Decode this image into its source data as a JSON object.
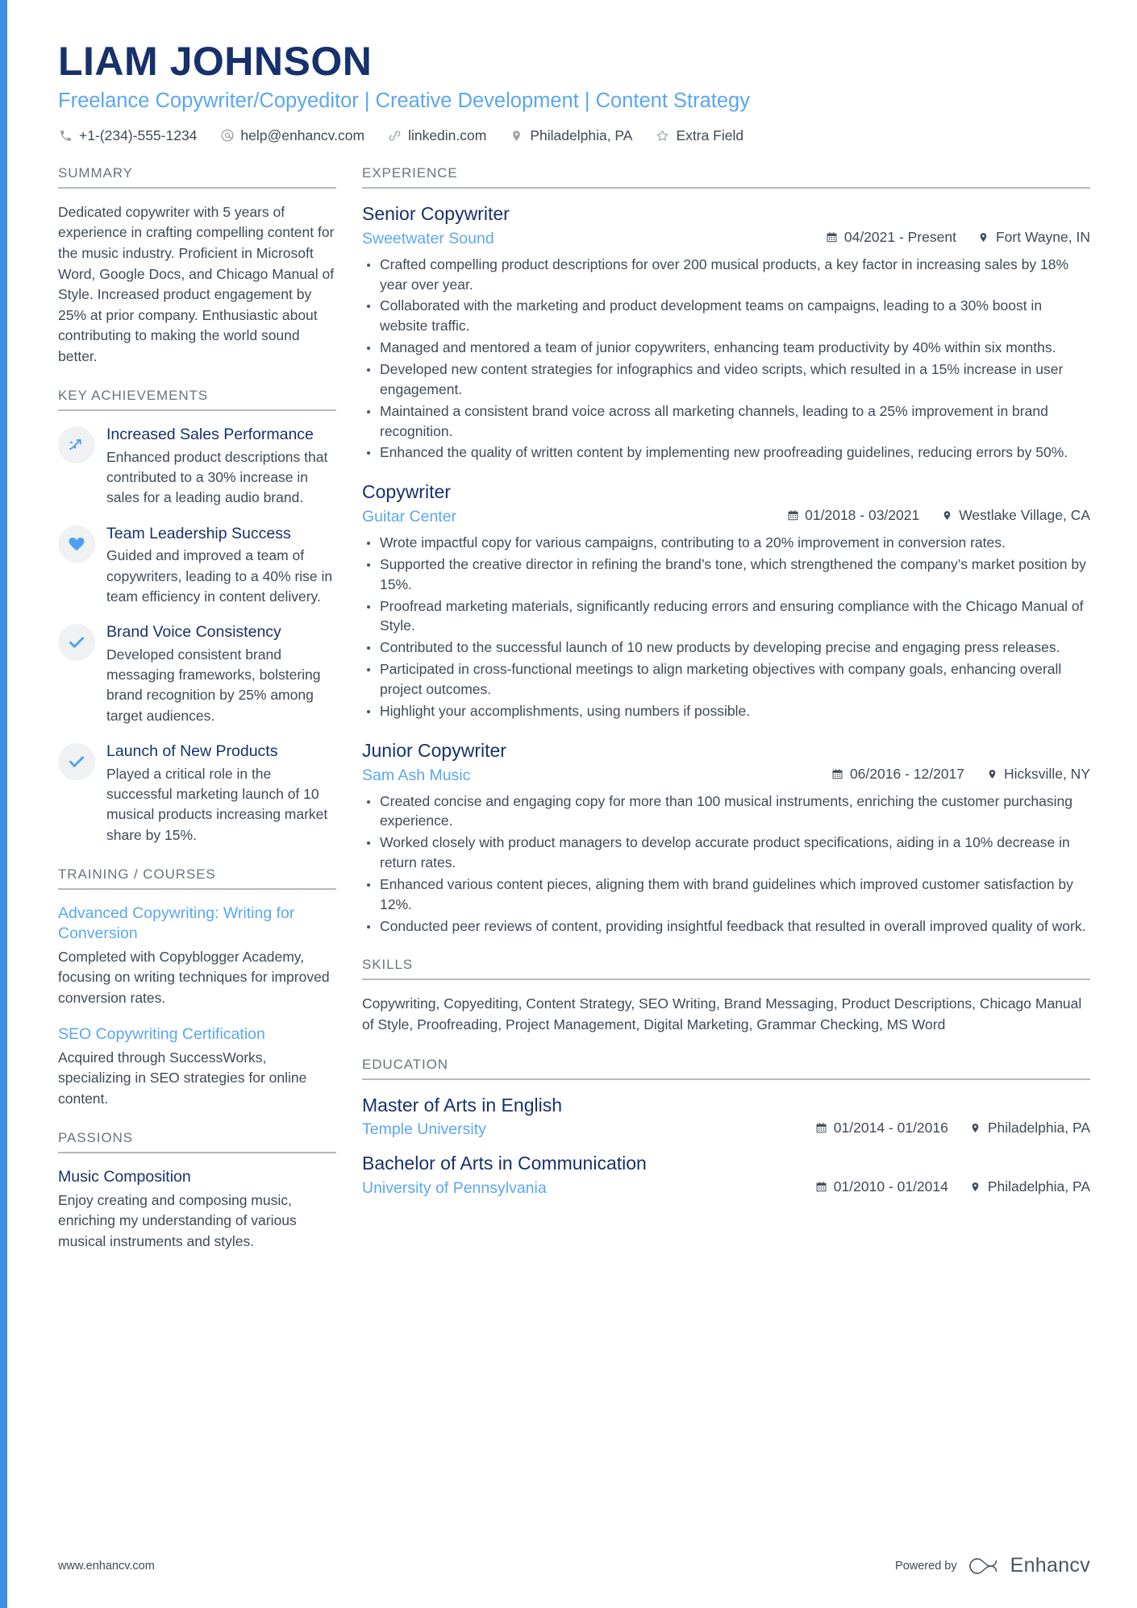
{
  "header": {
    "name": "LIAM JOHNSON",
    "headline": "Freelance Copywriter/Copyeditor | Creative Development | Content Strategy",
    "contacts": [
      {
        "icon": "phone-icon",
        "text": "+1-(234)-555-1234"
      },
      {
        "icon": "email-icon",
        "text": "help@enhancv.com"
      },
      {
        "icon": "link-icon",
        "text": "linkedin.com"
      },
      {
        "icon": "location-pin-icon",
        "text": "Philadelphia, PA"
      },
      {
        "icon": "star-icon",
        "text": "Extra Field"
      }
    ]
  },
  "sidebar": {
    "summary": {
      "title": "SUMMARY",
      "text": "Dedicated copywriter with 5 years of experience in crafting compelling content for the music industry. Proficient in Microsoft Word, Google Docs, and Chicago Manual of Style. Increased product engagement by 25% at prior company. Enthusiastic about contributing to making the world sound better."
    },
    "achievements": {
      "title": "KEY ACHIEVEMENTS",
      "items": [
        {
          "icon": "trending-up-icon",
          "title": "Increased Sales Performance",
          "desc": "Enhanced product descriptions that contributed to a 30% increase in sales for a leading audio brand."
        },
        {
          "icon": "heart-icon",
          "title": "Team Leadership Success",
          "desc": "Guided and improved a team of copywriters, leading to a 40% rise in team efficiency in content delivery."
        },
        {
          "icon": "check-icon",
          "title": "Brand Voice Consistency",
          "desc": "Developed consistent brand messaging frameworks, bolstering brand recognition by 25% among target audiences."
        },
        {
          "icon": "check-icon",
          "title": "Launch of New Products",
          "desc": "Played a critical role in the successful marketing launch of 10 musical products increasing market share by 15%."
        }
      ]
    },
    "training": {
      "title": "TRAINING / COURSES",
      "items": [
        {
          "title": "Advanced Copywriting: Writing for Conversion",
          "desc": "Completed with Copyblogger Academy, focusing on writing techniques for improved conversion rates."
        },
        {
          "title": "SEO Copywriting Certification",
          "desc": "Acquired through SuccessWorks, specializing in SEO strategies for online content."
        }
      ]
    },
    "passions": {
      "title": "PASSIONS",
      "items": [
        {
          "title": "Music Composition",
          "desc": "Enjoy creating and composing music, enriching my understanding of various musical instruments and styles."
        }
      ]
    }
  },
  "main": {
    "experience": {
      "title": "EXPERIENCE",
      "jobs": [
        {
          "role": "Senior Copywriter",
          "company": "Sweetwater Sound",
          "dates": "04/2021 - Present",
          "location": "Fort Wayne, IN",
          "bullets": [
            "Crafted compelling product descriptions for over 200 musical products, a key factor in increasing sales by 18% year over year.",
            "Collaborated with the marketing and product development teams on campaigns, leading to a 30% boost in website traffic.",
            "Managed and mentored a team of junior copywriters, enhancing team productivity by 40% within six months.",
            "Developed new content strategies for infographics and video scripts, which resulted in a 15% increase in user engagement.",
            "Maintained a consistent brand voice across all marketing channels, leading to a 25% improvement in brand recognition.",
            "Enhanced the quality of written content by implementing new proofreading guidelines, reducing errors by 50%."
          ]
        },
        {
          "role": "Copywriter",
          "company": "Guitar Center",
          "dates": "01/2018 - 03/2021",
          "location": "Westlake Village, CA",
          "bullets": [
            "Wrote impactful copy for various campaigns, contributing to a 20% improvement in conversion rates.",
            "Supported the creative director in refining the brand’s tone, which strengthened the company’s market position by 15%.",
            "Proofread marketing materials, significantly reducing errors and ensuring compliance with the Chicago Manual of Style.",
            "Contributed to the successful launch of 10 new products by developing precise and engaging press releases.",
            "Participated in cross-functional meetings to align marketing objectives with company goals, enhancing overall project outcomes.",
            "Highlight your accomplishments, using numbers if possible."
          ]
        },
        {
          "role": "Junior Copywriter",
          "company": "Sam Ash Music",
          "dates": "06/2016 - 12/2017",
          "location": "Hicksville, NY",
          "bullets": [
            "Created concise and engaging copy for more than 100 musical instruments, enriching the customer purchasing experience.",
            "Worked closely with product managers to develop accurate product specifications, aiding in a 10% decrease in return rates.",
            "Enhanced various content pieces, aligning them with brand guidelines which improved customer satisfaction by 12%.",
            "Conducted peer reviews of content, providing insightful feedback that resulted in overall improved quality of work."
          ]
        }
      ]
    },
    "skills": {
      "title": "SKILLS",
      "text": "Copywriting, Copyediting, Content Strategy, SEO Writing, Brand Messaging, Product Descriptions, Chicago Manual of Style, Proofreading, Project Management, Digital Marketing, Grammar Checking, MS Word"
    },
    "education": {
      "title": "EDUCATION",
      "items": [
        {
          "degree": "Master of Arts in English",
          "school": "Temple University",
          "dates": "01/2014 - 01/2016",
          "location": "Philadelphia, PA"
        },
        {
          "degree": "Bachelor of Arts in Communication",
          "school": "University of Pennsylvania",
          "dates": "01/2010 - 01/2014",
          "location": "Philadelphia, PA"
        }
      ]
    }
  },
  "footer": {
    "url": "www.enhancv.com",
    "powered_by": "Powered by",
    "brand": "Enhancv"
  },
  "colors": {
    "navy": "#16316b",
    "accent_blue": "#5aa7f0",
    "body_text": "#3f4a56",
    "muted": "#6a747d",
    "rule": "#b4b9bd",
    "badge_bg": "#f0f1f2"
  }
}
